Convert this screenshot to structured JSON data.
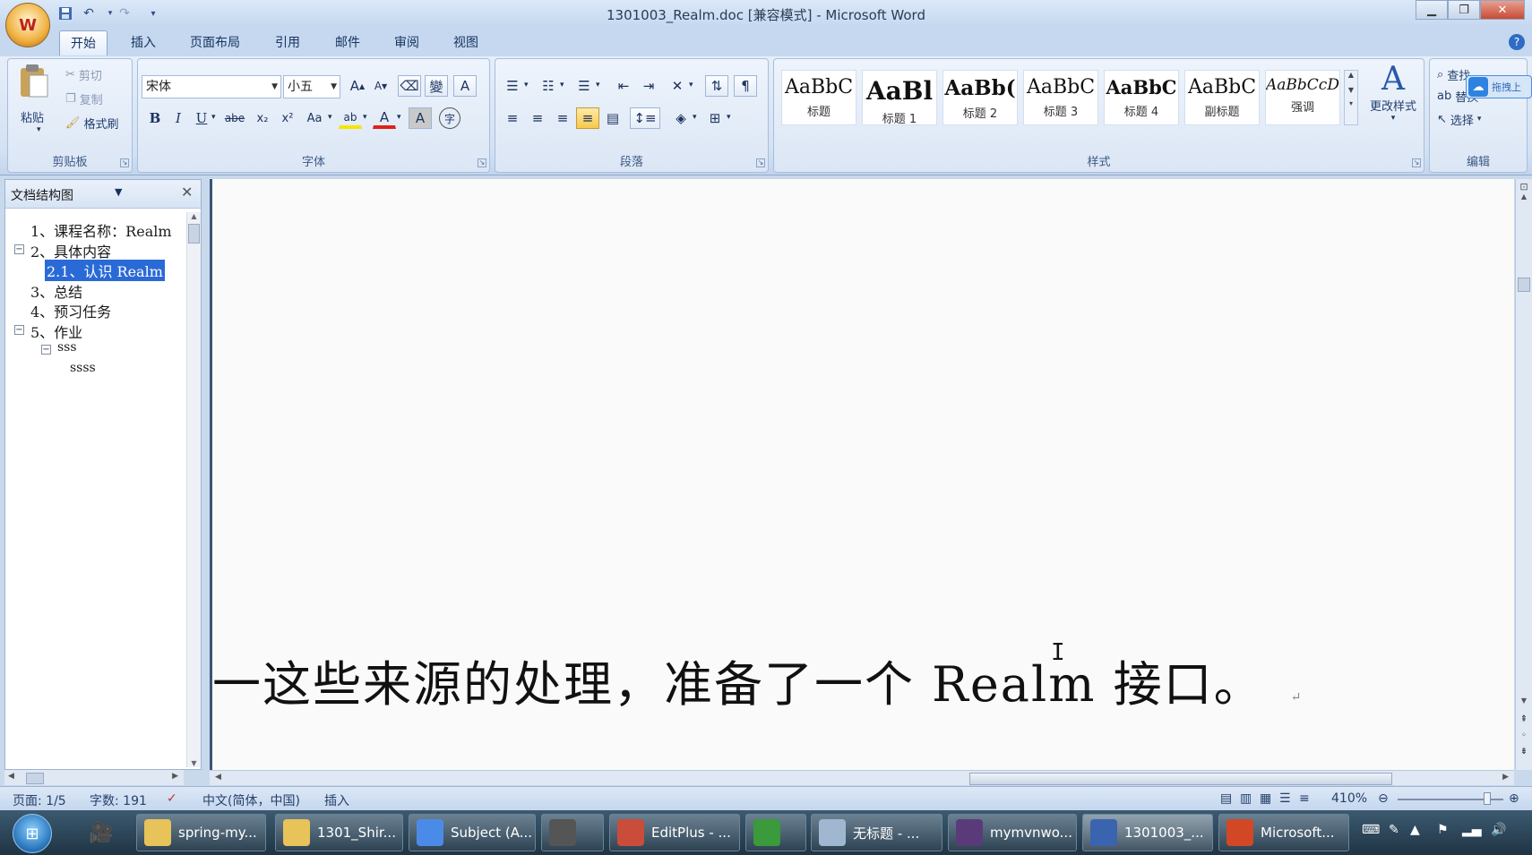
{
  "window": {
    "title": "1301003_Realm.doc [兼容模式] - Microsoft Word",
    "qat_icons": [
      "save-icon",
      "undo-icon",
      "redo-icon",
      "customize-qat-icon"
    ],
    "controls": [
      "minimize-icon",
      "restore-icon",
      "close-icon"
    ]
  },
  "tabs": [
    {
      "label": "开始",
      "active": true
    },
    {
      "label": "插入"
    },
    {
      "label": "页面布局"
    },
    {
      "label": "引用"
    },
    {
      "label": "邮件"
    },
    {
      "label": "审阅"
    },
    {
      "label": "视图"
    }
  ],
  "clipboard": {
    "paste": "粘贴",
    "cut": "剪切",
    "copy": "复制",
    "format_painter": "格式刷",
    "group_label": "剪贴板"
  },
  "font": {
    "name": "宋体",
    "size": "小五",
    "group_label": "字体",
    "grow": "A",
    "shrink": "A",
    "clear": "⌫",
    "phonetic": "變",
    "border_char": "A",
    "bold": "B",
    "italic": "I",
    "underline": "U",
    "strike": "abe",
    "subscript": "x₂",
    "superscript": "x²",
    "case": "Aa",
    "highlight": "ab",
    "font_color": "A",
    "shading_char": "A",
    "enclose": "字"
  },
  "paragraph": {
    "group_label": "段落"
  },
  "styles": {
    "group_label": "样式",
    "items": [
      {
        "sample": "AaBbC",
        "name": "标题",
        "size": 22,
        "bold": false
      },
      {
        "sample": "AaBl",
        "name": "标题 1",
        "size": 28,
        "bold": true
      },
      {
        "sample": "AaBb(",
        "name": "标题 2",
        "size": 23,
        "bold": true
      },
      {
        "sample": "AaBbC",
        "name": "标题 3",
        "size": 22,
        "bold": false
      },
      {
        "sample": "AaBbC",
        "name": "标题 4",
        "size": 21,
        "bold": true
      },
      {
        "sample": "AaBbC",
        "name": "副标题",
        "size": 22,
        "bold": false
      },
      {
        "sample": "AaBbCcD",
        "name": "强调",
        "size": 17,
        "bold": false,
        "italic": true
      }
    ],
    "change_styles": "更改样式"
  },
  "editing": {
    "group_label": "编辑",
    "find": "查找",
    "replace": "替换",
    "select": "选择",
    "floating_badge": "拖拽上"
  },
  "navpane": {
    "title": "文档结构图",
    "items": [
      {
        "text": "1、课程名称：Realm",
        "level": 0,
        "toggle": ""
      },
      {
        "text": "2、具体内容",
        "level": 0,
        "toggle": "−"
      },
      {
        "text": "2.1、认识 Realm",
        "level": 1,
        "toggle": "",
        "selected": true
      },
      {
        "text": "3、总结",
        "level": 0,
        "toggle": ""
      },
      {
        "text": "4、预习任务",
        "level": 0,
        "toggle": ""
      },
      {
        "text": "5、作业",
        "level": 0,
        "toggle": "−"
      },
      {
        "text": "sss",
        "level": 1,
        "toggle": "−"
      },
      {
        "text": "ssss",
        "level": 2,
        "toggle": ""
      }
    ]
  },
  "document": {
    "visible_text": "一这些来源的处理，准备了一个 Realm 接口。",
    "paragraph_mark": "↵"
  },
  "statusbar": {
    "page": "页面: 1/5",
    "words": "字数: 191",
    "language": "中文(简体，中国)",
    "mode": "插入",
    "zoom": "410%"
  },
  "taskbar": {
    "items": [
      {
        "label": "spring-my...",
        "icon": "folder-icon",
        "color": "#e8c35a"
      },
      {
        "label": "1301_Shir...",
        "icon": "folder-icon",
        "color": "#e8c35a"
      },
      {
        "label": "Subject (A...",
        "icon": "chrome-icon",
        "color": "#4b8be8"
      },
      {
        "label": "",
        "icon": "sublime-icon",
        "color": "#555555"
      },
      {
        "label": "EditPlus - ...",
        "icon": "editplus-icon",
        "color": "#c94d3a"
      },
      {
        "label": "",
        "icon": "frog-icon",
        "color": "#3b9a3b"
      },
      {
        "label": "无标题 - ...",
        "icon": "notepad-icon",
        "color": "#9fb8cf"
      },
      {
        "label": "mymvnwo...",
        "icon": "eclipse-icon",
        "color": "#5b3a7a"
      },
      {
        "label": "1301003_...",
        "icon": "word-icon",
        "color": "#3a64b0",
        "active": true
      },
      {
        "label": "Microsoft...",
        "icon": "powerpoint-icon",
        "color": "#d24726"
      }
    ]
  }
}
